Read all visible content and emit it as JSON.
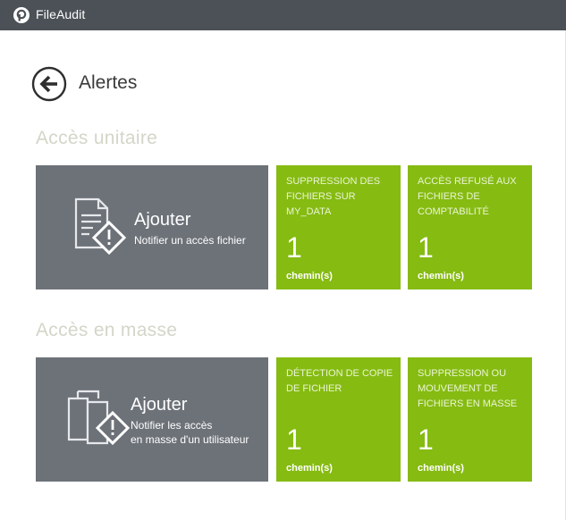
{
  "app": {
    "name": "FileAudit"
  },
  "page": {
    "title": "Alertes"
  },
  "sections": [
    {
      "title": "Accès unitaire",
      "add_tile": {
        "title": "Ajouter",
        "subtitle_lines": [
          "Notifier un accès fichier"
        ]
      },
      "alerts": [
        {
          "name": "Suppression des fichiers sur MY_DATA",
          "count": "1",
          "unit": "chemin(s)"
        },
        {
          "name": "Accès refusé aux fichiers de comptabilité",
          "count": "1",
          "unit": "chemin(s)"
        }
      ]
    },
    {
      "title": "Accès en masse",
      "add_tile": {
        "title": "Ajouter",
        "subtitle_lines": [
          "Notifier les accès",
          "en masse d'un utilisateur"
        ]
      },
      "alerts": [
        {
          "name": "Détection de copie de fichier",
          "count": "1",
          "unit": "chemin(s)"
        },
        {
          "name": "Suppression ou mouvement de fichiers en masse",
          "count": "1",
          "unit": "chemin(s)"
        }
      ]
    }
  ],
  "colors": {
    "titlebar": "#4b5157",
    "add_tile": "#6d7279",
    "alert_tile": "#86bb12",
    "section_title": "#d3d6c8"
  }
}
